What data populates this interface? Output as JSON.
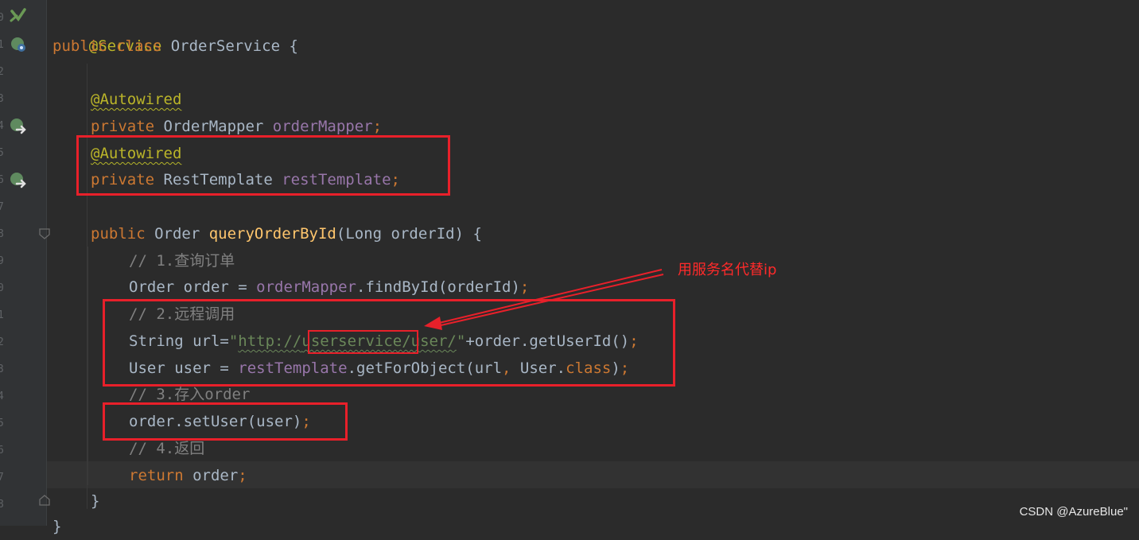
{
  "gutter": {
    "line_numbers": [
      "0",
      "1",
      "2",
      "3",
      "4",
      "5",
      "6",
      "7",
      "8",
      "9",
      "0",
      "1",
      "2",
      "3",
      "4",
      "5",
      "6",
      "7",
      "8",
      "9"
    ]
  },
  "code": {
    "line1": {
      "annotation": "@Service"
    },
    "line2": {
      "kw_public": "public",
      "kw_class": "class",
      "class_name": " OrderService {"
    },
    "line4": {
      "annotation": "@Autowired"
    },
    "line5": {
      "kw": "private",
      "type": " OrderMapper ",
      "field": "orderMapper",
      "semi": ";"
    },
    "line6": {
      "annotation": "@Autowired"
    },
    "line7": {
      "kw": "private",
      "type": " RestTemplate ",
      "field": "restTemplate",
      "semi": ";"
    },
    "line9": {
      "kw": "public",
      "type": " Order ",
      "method": "queryOrderById",
      "params": "(Long orderId) {"
    },
    "line10": {
      "comment": "// 1.查询订单"
    },
    "line11": {
      "lhs": "Order order = ",
      "field": "orderMapper",
      "rest": ".findById(orderId)",
      "semi": ";"
    },
    "line12": {
      "comment": "// 2.远程调用"
    },
    "line13": {
      "lhs": "String url=",
      "q1": "\"",
      "url_scheme": "http://",
      "url_host": "userservice",
      "url_path": "/user/",
      "q2": "\"",
      "rest": "+order.getUserId()",
      "semi": ";"
    },
    "line14": {
      "lhs": "User user = ",
      "field": "restTemplate",
      "rest1": ".getForObject(url",
      "comma": ",",
      "rest2": " User.",
      "kw_class": "class",
      "rest3": ")",
      "semi": ";"
    },
    "line15": {
      "comment": "// 3.存入order"
    },
    "line16": {
      "text": "order.setUser(user)",
      "semi": ";"
    },
    "line17": {
      "comment": "// 4.返回"
    },
    "line18": {
      "kw": "return",
      "text": " order",
      "semi": ";"
    },
    "line19": {
      "text": "}"
    },
    "line20": {
      "text": "}"
    }
  },
  "annotation_note": "用服务名代替ip",
  "watermark": "CSDN @AzureBlue\"",
  "colors": {
    "background": "#2b2b2b",
    "keyword": "#cc7832",
    "annotation": "#bbb529",
    "field": "#9876aa",
    "method": "#ffc66d",
    "string": "#6a8759",
    "comment": "#808080",
    "highlight_box": "#e8202a"
  },
  "icons": {
    "gutter_bean_icon": "spring-bean-icon",
    "gutter_autowired_icon": "spring-autowired-icon",
    "fold_icon": "fold-icon"
  }
}
